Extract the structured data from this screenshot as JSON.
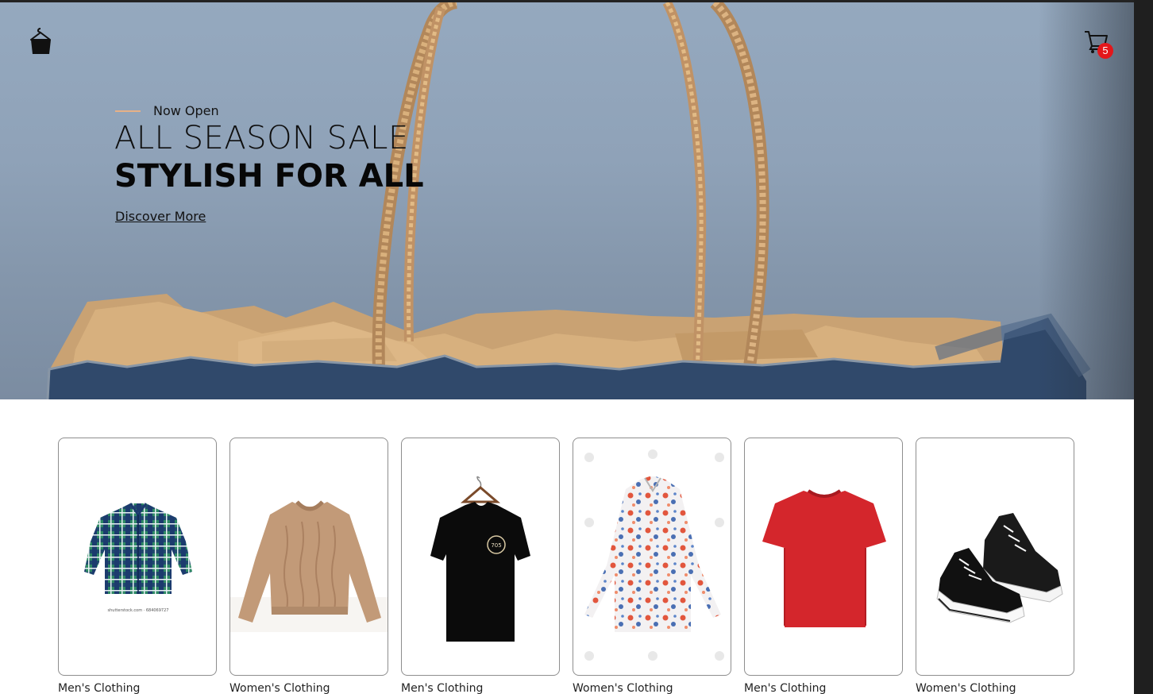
{
  "header": {
    "logo_icon": "hanger-bag-icon",
    "cart_icon": "shopping-cart-icon",
    "cart_count": "5"
  },
  "hero": {
    "eyebrow": "Now Open",
    "headline": "ALL SEASON SALE",
    "subheadline": "STYLISH FOR ALL",
    "cta": "Discover More"
  },
  "products": [
    {
      "category": "Men's Clothing",
      "image": "green-plaid-shirt"
    },
    {
      "category": "Women's Clothing",
      "image": "beige-knit-sweater"
    },
    {
      "category": "Men's Clothing",
      "image": "black-tshirt-on-hanger"
    },
    {
      "category": "Women's Clothing",
      "image": "floral-blouse"
    },
    {
      "category": "Men's Clothing",
      "image": "red-tshirt"
    },
    {
      "category": "Women's Clothing",
      "image": "black-canvas-sneakers"
    }
  ],
  "colors": {
    "accent_line": "#e7b187",
    "badge": "#e3171b",
    "card_border": "#8e8e8e"
  }
}
